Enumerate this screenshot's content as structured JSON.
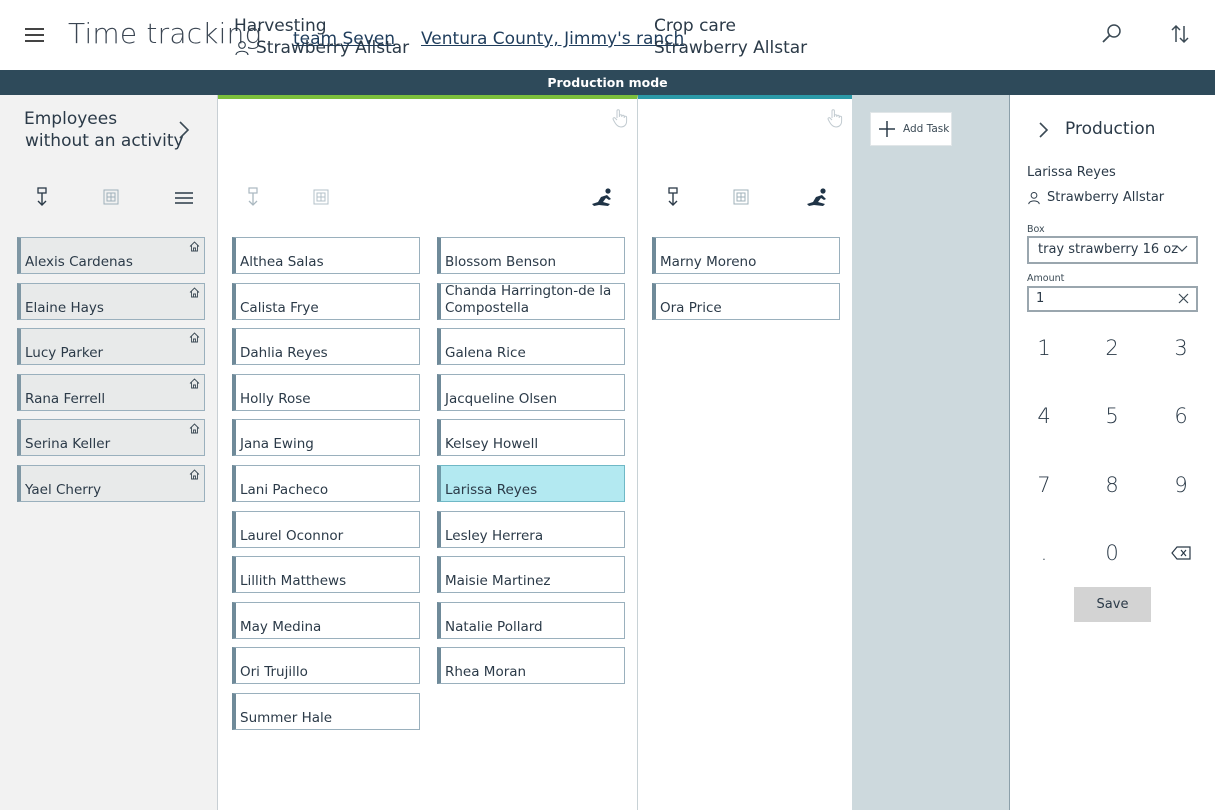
{
  "header": {
    "title": "Time tracking",
    "team_link": "team Seven",
    "location_link": "Ventura County, Jimmy's ranch",
    "icons": [
      "menu-icon",
      "search-icon",
      "sort-icon"
    ]
  },
  "mode_bar": {
    "label": "Production mode"
  },
  "left_panel": {
    "title_line1": "Employees",
    "title_line2": "without an activity",
    "employees": [
      "Alexis Cardenas",
      "Elaine Hays",
      "Lucy Parker",
      "Rana Ferrell",
      "Serina Keller",
      "Yael Cherry"
    ]
  },
  "harvesting": {
    "title": "Harvesting",
    "crop": "Strawberry Allstar",
    "accent_color": "#7cbf3c",
    "col1": [
      "Althea Salas",
      "Calista Frye",
      "Dahlia Reyes",
      "Holly Rose",
      "Jana Ewing",
      "Lani Pacheco",
      "Laurel Oconnor",
      "Lillith Matthews",
      "May Medina",
      "Ori Trujillo",
      "Summer Hale"
    ],
    "col2": [
      "Blossom Benson",
      "Chanda Harrington-de la",
      "Compostella",
      "Galena Rice",
      "Jacqueline Olsen",
      "Kelsey Howell",
      "Larissa Reyes",
      "Lesley Herrera",
      "Maisie Martinez",
      "Natalie Pollard",
      "Rhea Moran"
    ],
    "selected": "Larissa Reyes"
  },
  "crop_care": {
    "title": "Crop care",
    "crop": "Strawberry Allstar",
    "accent_color": "#2c9aa8",
    "employees": [
      "Marny Moreno",
      "Ora Price"
    ]
  },
  "add_task": {
    "label": "Add Task"
  },
  "production": {
    "title": "Production",
    "employee": "Larissa Reyes",
    "crop": "Strawberry Allstar",
    "box_label": "Box",
    "box_value": "tray strawberry 16 oz",
    "amount_label": "Amount",
    "amount_value": "1",
    "keys": [
      "1",
      "2",
      "3",
      "4",
      "5",
      "6",
      "7",
      "8",
      "9",
      ".",
      "0"
    ],
    "save_label": "Save"
  }
}
